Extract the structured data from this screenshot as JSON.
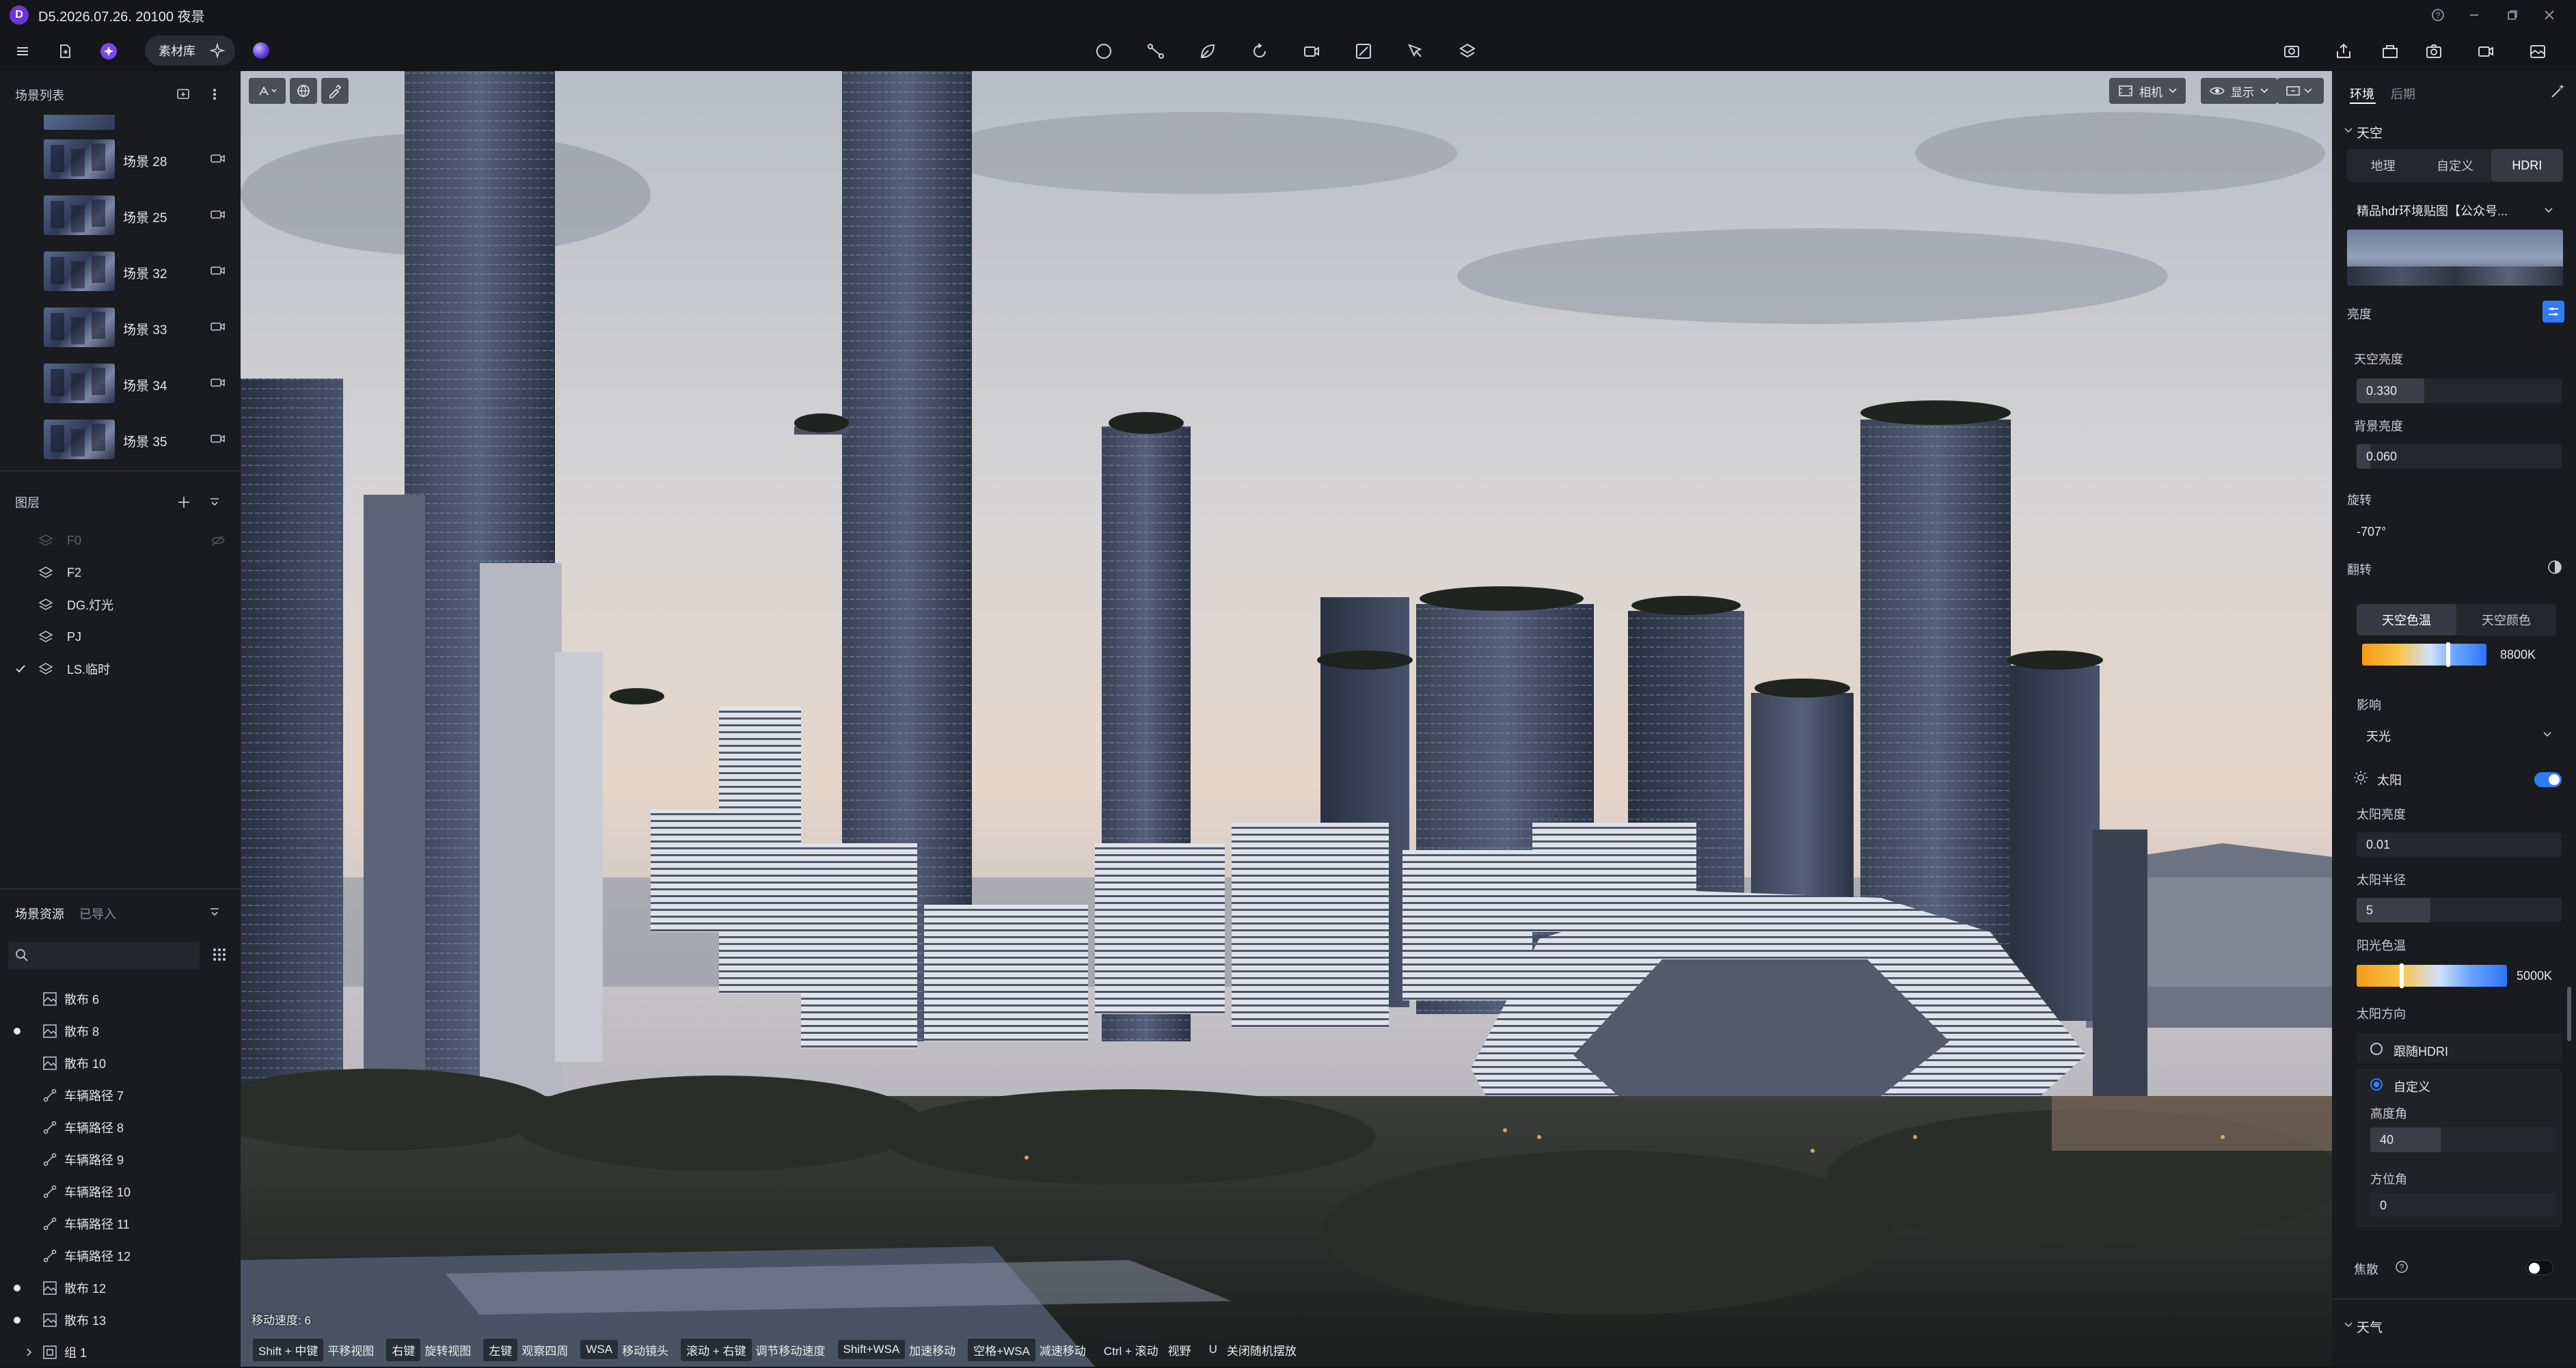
{
  "window": {
    "title": "D5.2026.07.26. 20100 夜景",
    "logo_letter": "D"
  },
  "toolbar": {
    "material_label": "素材库"
  },
  "left": {
    "scenes_header": "场景列表",
    "scenes": [
      "场景 28",
      "场景 25",
      "场景 32",
      "场景 33",
      "场景 34",
      "场景 35"
    ],
    "layers_header": "图层",
    "layers": [
      {
        "name": "F0",
        "checked": false,
        "dim": true
      },
      {
        "name": "F2",
        "checked": false,
        "dim": false
      },
      {
        "name": "DG.灯光",
        "checked": false,
        "dim": false
      },
      {
        "name": "PJ",
        "checked": false,
        "dim": false
      },
      {
        "name": "LS.临时",
        "checked": true,
        "dim": false
      }
    ],
    "assets_tabs": [
      "场景资源",
      "已导入"
    ],
    "assets": [
      {
        "name": "散布 6",
        "icon": "scatter-icon",
        "dot": false
      },
      {
        "name": "散布 8",
        "icon": "scatter-icon",
        "dot": true
      },
      {
        "name": "散布 10",
        "icon": "scatter-icon",
        "dot": false
      },
      {
        "name": "车辆路径 7",
        "icon": "path-icon",
        "dot": false
      },
      {
        "name": "车辆路径 8",
        "icon": "path-icon",
        "dot": false
      },
      {
        "name": "车辆路径 9",
        "icon": "path-icon",
        "dot": false
      },
      {
        "name": "车辆路径 10",
        "icon": "path-icon",
        "dot": false
      },
      {
        "name": "车辆路径 11",
        "icon": "path-icon",
        "dot": false
      },
      {
        "name": "车辆路径 12",
        "icon": "path-icon",
        "dot": false
      },
      {
        "name": "散布 12",
        "icon": "scatter-icon",
        "dot": true
      },
      {
        "name": "散布 13",
        "icon": "scatter-icon",
        "dot": true
      },
      {
        "name": "组 1",
        "icon": "group-icon",
        "dot": false
      }
    ]
  },
  "viewport": {
    "camera_label": "相机",
    "display_label": "显示",
    "speed_text": "移动速度: 6",
    "shortcuts": [
      {
        "key": "Shift + 中键",
        "desc": "平移视图"
      },
      {
        "key": "右键",
        "desc": "旋转视图"
      },
      {
        "key": "左键",
        "desc": "观察四周"
      },
      {
        "key": "WSA",
        "desc": "移动镜头"
      },
      {
        "key": "滚动 + 右键",
        "desc": "调节移动速度"
      },
      {
        "key": "Shift+WSA",
        "desc": "加速移动"
      },
      {
        "key": "空格+WSA",
        "desc": "减速移动"
      },
      {
        "key": "Ctrl + 滚动",
        "desc": "视野"
      },
      {
        "key": "U",
        "desc": "关闭随机摆放"
      }
    ]
  },
  "right": {
    "tabs": [
      "环境",
      "后期"
    ],
    "sky_header": "天空",
    "sky_modes": [
      "地理",
      "自定义",
      "HDRI"
    ],
    "sky_mode_selected": "HDRI",
    "hdri_name": "精品hdr环境贴图【公众号...",
    "brightness_label": "亮度",
    "sky_brightness_label": "天空亮度",
    "sky_brightness_value": "0.330",
    "sky_brightness_level": 0.33,
    "bg_brightness_label": "背景亮度",
    "bg_brightness_value": "0.060",
    "rotation_label": "旋转",
    "rotation_value": "-707°",
    "flip_label": "翻转",
    "color_tabs": [
      "天空色温",
      "天空颜色"
    ],
    "sky_temp_value": "8800K",
    "sky_temp_level": 0.69,
    "influence_label": "影响",
    "influence_value": "天光",
    "sun_label": "太阳",
    "sun_brightness_label": "太阳亮度",
    "sun_brightness_value": "0.01",
    "sun_radius_label": "太阳半径",
    "sun_radius_value": "5",
    "sun_radius_level": 0.36,
    "sun_temp_label": "阳光色温",
    "sun_temp_value": "5000K",
    "sun_temp_level": 0.3,
    "sun_dir_label": "太阳方向",
    "follow_hdri_label": "跟随HDRI",
    "custom_label": "自定义",
    "altitude_label": "高度角",
    "altitude_value": "40",
    "altitude_level": 0.38,
    "azimuth_label": "方位角",
    "azimuth_value": "0",
    "caustics_label": "焦散",
    "weather_header": "天气",
    "colors": {
      "accent": "#2f7cf6",
      "panel": "#1a1b1f"
    }
  }
}
